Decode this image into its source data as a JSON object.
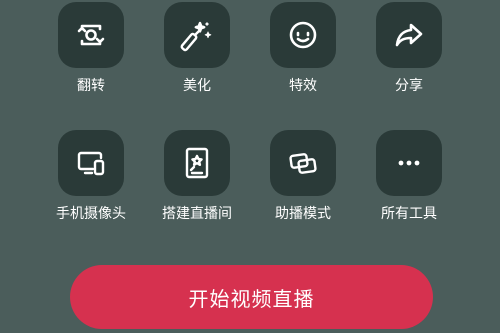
{
  "tools": [
    {
      "label": "翻转",
      "icon": "flip-camera-icon"
    },
    {
      "label": "美化",
      "icon": "magic-wand-icon"
    },
    {
      "label": "特效",
      "icon": "smiley-face-icon"
    },
    {
      "label": "分享",
      "icon": "share-arrow-icon"
    },
    {
      "label": "手机摄像头",
      "icon": "phone-camera-icon"
    },
    {
      "label": "搭建直播间",
      "icon": "live-room-setup-icon"
    },
    {
      "label": "助播模式",
      "icon": "assistant-mode-icon"
    },
    {
      "label": "所有工具",
      "icon": "more-dots-icon"
    }
  ],
  "start_button": {
    "label": "开始视频直播"
  },
  "colors": {
    "background": "#4b5d5b",
    "icon_tile": "#2a3a38",
    "accent": "#d6314f"
  }
}
